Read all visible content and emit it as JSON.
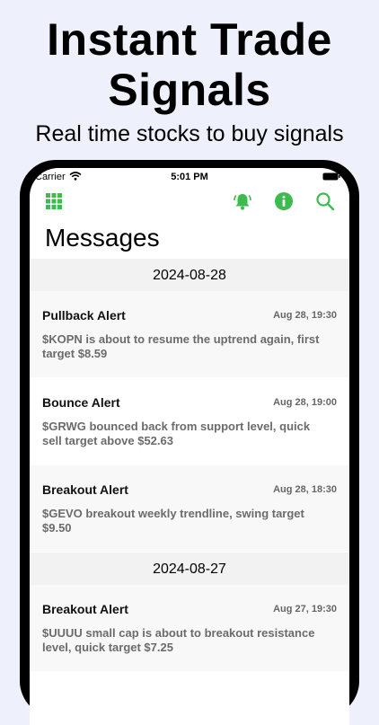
{
  "promo": {
    "headline": "Instant Trade Signals",
    "subhead": "Real time stocks to buy signals"
  },
  "status_bar": {
    "carrier": "Carrier",
    "time": "5:01 PM"
  },
  "toolbar": {
    "icons": [
      "grid-icon",
      "bell-icon",
      "info-icon",
      "search-icon"
    ],
    "accent_color": "#3dbb4f"
  },
  "page": {
    "title": "Messages"
  },
  "groups": [
    {
      "date": "2024-08-28",
      "messages": [
        {
          "title": "Pullback Alert",
          "time": "Aug 28, 19:30",
          "body": "$KOPN is about to resume the uptrend again, first target $8.59"
        },
        {
          "title": "Bounce Alert",
          "time": "Aug 28, 19:00",
          "body": "$GRWG bounced back from support level, quick sell target above $52.63"
        },
        {
          "title": "Breakout Alert",
          "time": "Aug 28, 18:30",
          "body": "$GEVO breakout weekly trendline, swing target $9.50"
        }
      ]
    },
    {
      "date": "2024-08-27",
      "messages": [
        {
          "title": "Breakout Alert",
          "time": "Aug 27, 19:30",
          "body": "$UUUU small cap is about to breakout resistance level, quick target $7.25"
        }
      ]
    }
  ]
}
